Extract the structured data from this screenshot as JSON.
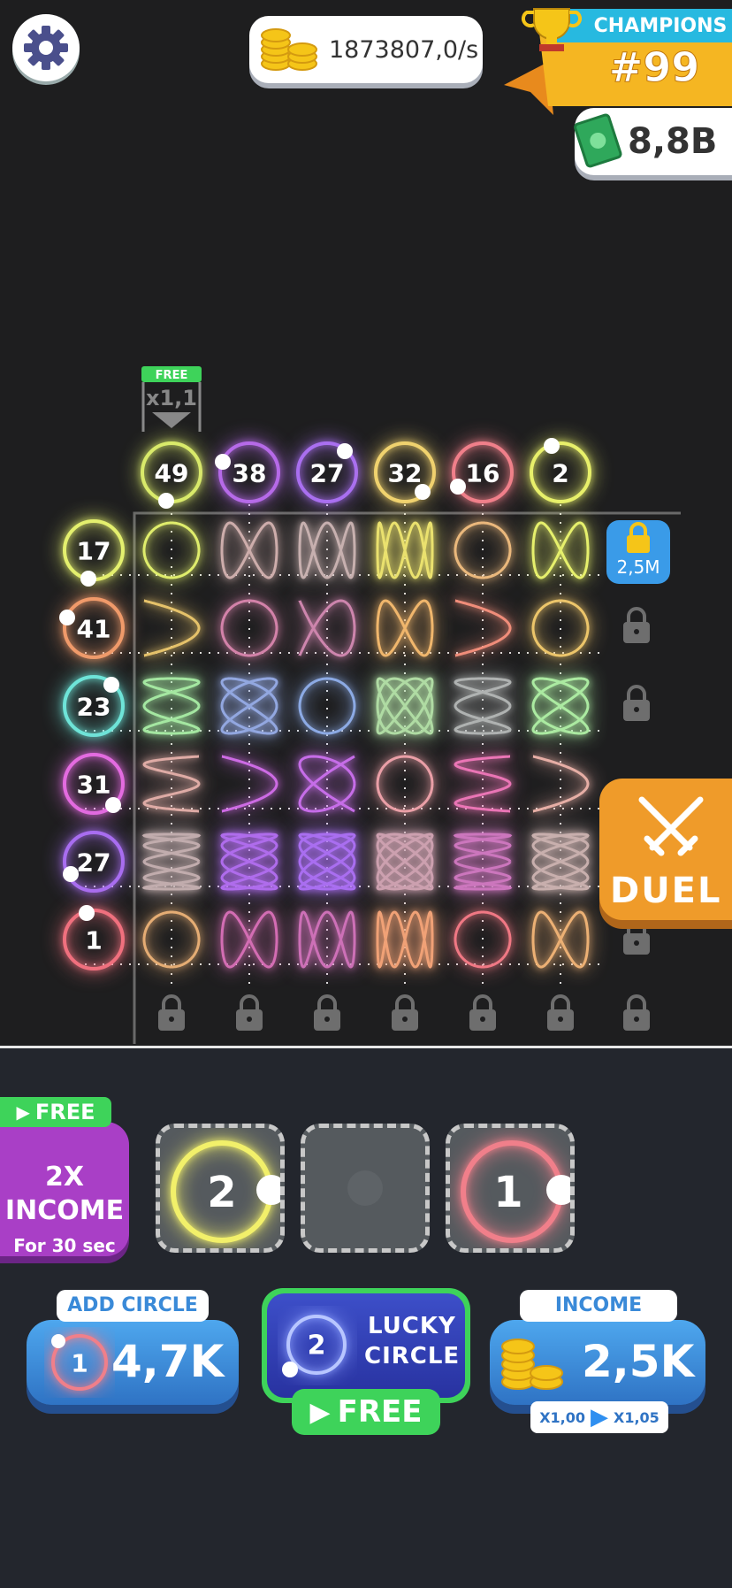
{
  "header": {
    "settings_icon": "gear-icon",
    "coin_rate": "1873807,0/s",
    "champions_label": "CHAMPIONS",
    "rank": "#99",
    "cash": "8,8B"
  },
  "board": {
    "boost_tag": "FREE",
    "boost_multiplier": "x1,1",
    "column_circles": [
      {
        "label": "49",
        "color": "#d9ea6a"
      },
      {
        "label": "38",
        "color": "#b66ae8"
      },
      {
        "label": "27",
        "color": "#a96ff0"
      },
      {
        "label": "32",
        "color": "#f0d26e"
      },
      {
        "label": "16",
        "color": "#f07f8a"
      },
      {
        "label": "2",
        "color": "#e8f06a"
      }
    ],
    "row_circles": [
      {
        "label": "17",
        "color": "#e4f06e"
      },
      {
        "label": "41",
        "color": "#f09a6a"
      },
      {
        "label": "23",
        "color": "#6ee4d8"
      },
      {
        "label": "31",
        "color": "#e36be0"
      },
      {
        "label": "27",
        "color": "#a86df0"
      },
      {
        "label": "1",
        "color": "#f0707e"
      }
    ],
    "unlock_price": "2,5M",
    "duel_label": "DUEL"
  },
  "bottom": {
    "free_badge": "FREE",
    "boost_line1": "2X",
    "boost_line2": "INCOME",
    "boost_line3": "For 30 sec",
    "slots": [
      {
        "label": "2",
        "color": "#f2f06a"
      },
      {
        "label": "",
        "color": ""
      },
      {
        "label": "1",
        "color": "#f07f8a"
      }
    ],
    "add_circle": {
      "tag": "ADD CIRCLE",
      "circle": "1",
      "price": "4,7K"
    },
    "lucky_circle": {
      "circle": "2",
      "line1": "LUCKY",
      "line2": "CIRCLE",
      "free": "FREE"
    },
    "income": {
      "tag": "INCOME",
      "value": "2,5K",
      "from": "X1,00",
      "to": "X1,05"
    }
  }
}
